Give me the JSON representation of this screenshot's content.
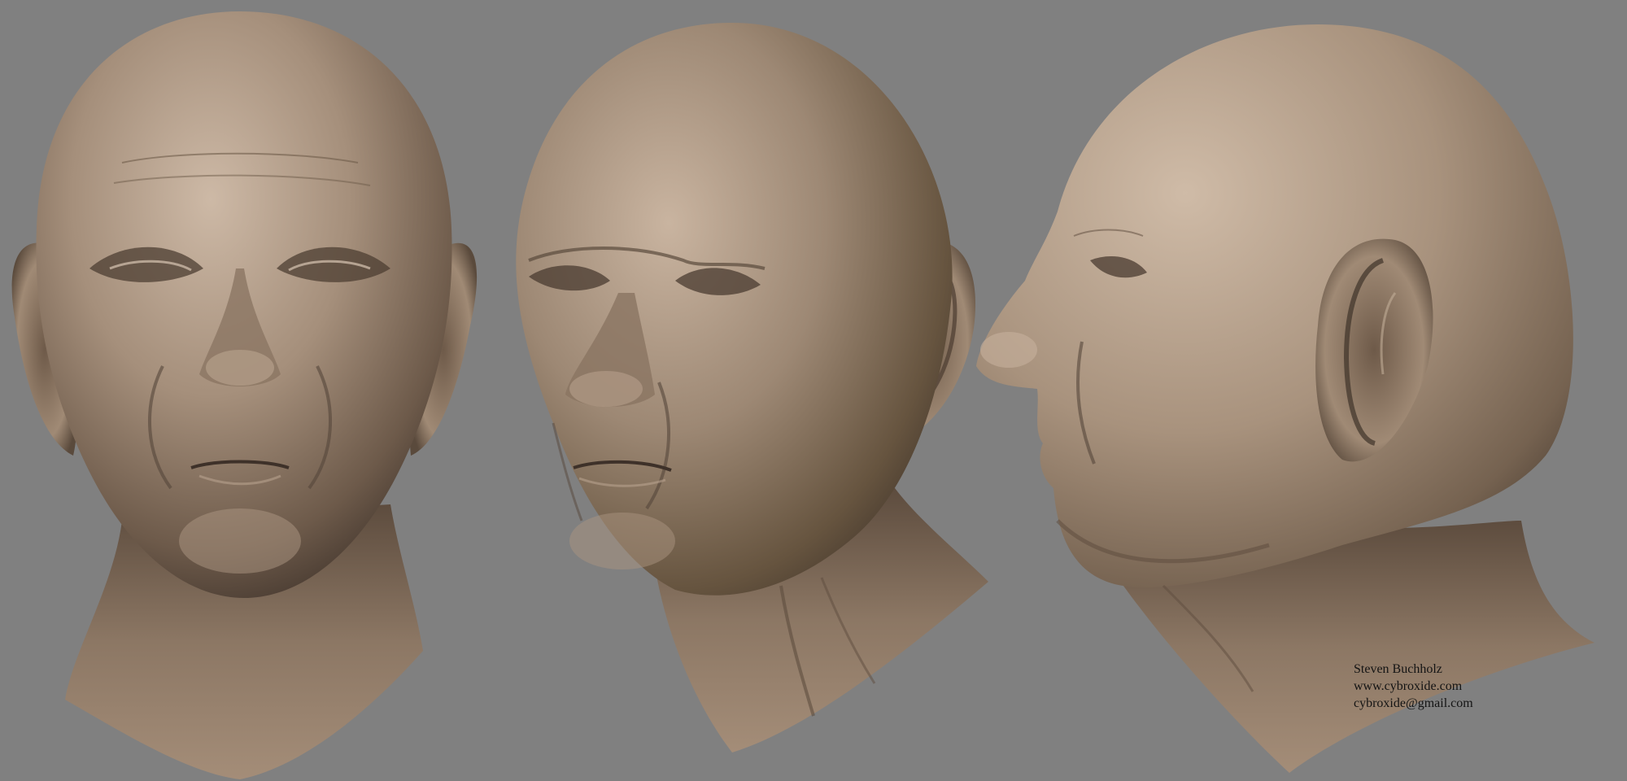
{
  "credit": {
    "name": "Steven Buchholz",
    "website": "www.cybroxide.com",
    "email": "cybroxide@gmail.com"
  },
  "colors": {
    "background": "#808080",
    "skin_light": "#c7b29f",
    "skin_mid": "#9a8572",
    "skin_dark": "#4b3d32",
    "text": "#141414"
  }
}
